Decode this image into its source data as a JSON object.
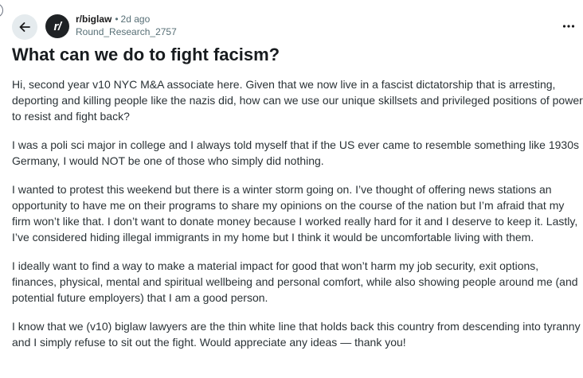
{
  "header": {
    "back_icon": "arrow-left-icon",
    "avatar_text": "r/",
    "subreddit": "r/biglaw",
    "separator": "•",
    "age": "2d ago",
    "username": "Round_Research_2757",
    "overflow_icon": "more-horizontal-icon"
  },
  "post": {
    "title": "What can we do to fight facism?",
    "paragraphs": [
      "Hi, second year v10 NYC M&A associate here. Given that we now live in a fascist dictatorship that is arresting, deporting and killing people like the nazis did, how can we use our unique skillsets and privileged positions of power to resist and fight back?",
      "I was a poli sci major in college and I always told myself that if the US ever came to resemble something like 1930s Germany, I would NOT be one of those who simply did nothing.",
      "I wanted to protest this weekend but there is a winter storm going on. I’ve thought of offering news stations an opportunity to have me on their programs to share my opinions on the course of the nation but I’m afraid that my firm won’t like that. I don’t want to donate money because I worked really hard for it and I deserve to keep it. Lastly, I’ve considered hiding illegal immigrants in my home but I think it would be uncomfortable living with them.",
      "I ideally want to find a way to make a material impact for good that won’t harm my job security, exit options, finances, physical, mental and spiritual wellbeing and personal comfort, while also showing people around me (and potential future employers) that I am a good person.",
      "I know that we (v10) biglaw lawyers are the thin white line that holds back this country from descending into tyranny and I simply refuse to sit out the fight. Would appreciate any ideas — thank you!"
    ]
  },
  "colors": {
    "background": "#ffffff",
    "text_primary": "#1a1a1b",
    "text_secondary": "#576f76",
    "body_text": "#2a3236",
    "back_button_bg": "#e5ebee",
    "avatar_bg": "#1f2225"
  }
}
